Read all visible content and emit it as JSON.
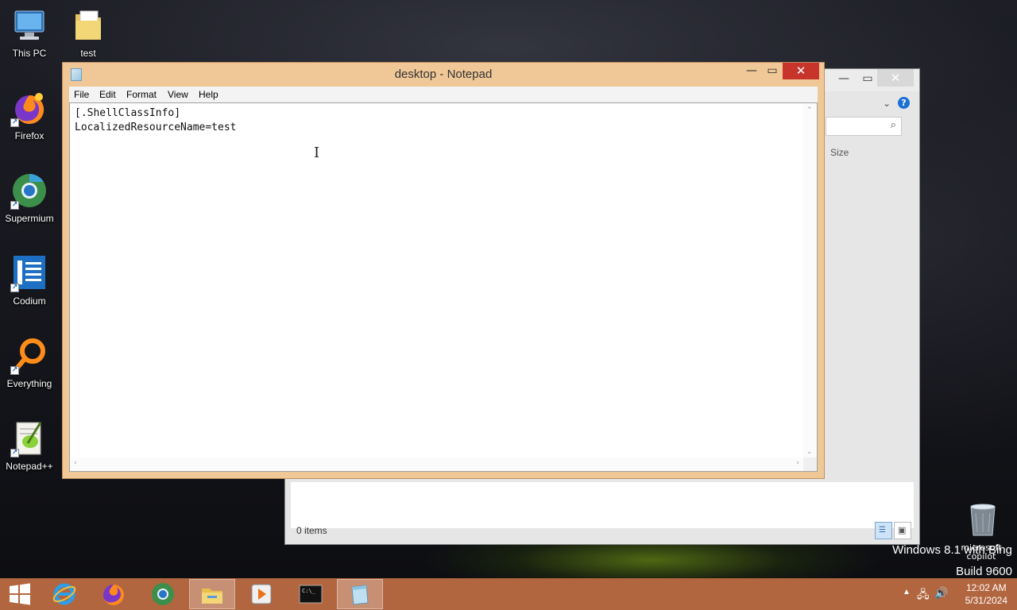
{
  "desktop": {
    "icons": [
      {
        "label": "This PC"
      },
      {
        "label": "test"
      },
      {
        "label": "Firefox"
      },
      {
        "label": "Supermium"
      },
      {
        "label": "Codium"
      },
      {
        "label": "Everything"
      },
      {
        "label": "Notepad++"
      }
    ]
  },
  "explorer": {
    "column_header": "Size",
    "status_text": "0 items"
  },
  "notepad": {
    "title": "desktop - Notepad",
    "menu": [
      "File",
      "Edit",
      "Format",
      "View",
      "Help"
    ],
    "content": "[.ShellClassInfo]\nLocalizedResourceName=test"
  },
  "watermark": {
    "line1": "Windows 8.1 with Bing",
    "overlay": "microsoft copilot",
    "line2": "Build 9600"
  },
  "taskbar": {
    "time": "12:02 AM",
    "date": "5/31/2024",
    "colors": {
      "taskbar": "#b2663f",
      "close_button": "#c7342c"
    }
  }
}
